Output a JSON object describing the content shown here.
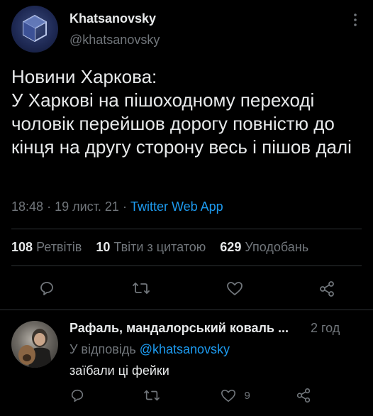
{
  "tweet": {
    "author_name": "Khatsanovsky",
    "author_handle": "@khatsanovsky",
    "text": "Новини Харкова:\nУ Харкові на пішоходному переході чоловік перейшов дорогу повністю до кінця на другу сторону весь і пішов далі",
    "time": "18:48",
    "date": "19 лист. 21",
    "source": "Twitter Web App",
    "separator": "·",
    "stats": {
      "retweets_count": "108",
      "retweets_label": "Ретвітів",
      "quotes_count": "10",
      "quotes_label": "Твіти з цитатою",
      "likes_count": "629",
      "likes_label": "Уподобань"
    }
  },
  "reply": {
    "author_name": "Рафаль, мандалорський коваль ...",
    "time_ago": "2 год",
    "reply_prefix": "У відповідь",
    "reply_to": "@khatsanovsky",
    "text": "заїбали ці фейки",
    "like_count": "9"
  },
  "icons": {
    "more": "more-vertical-icon",
    "reply": "speech-bubble-icon",
    "retweet": "retweet-arrows-icon",
    "like": "heart-icon",
    "share": "share-nodes-icon"
  },
  "colors": {
    "background": "#000000",
    "text": "#e7e9ea",
    "muted": "#71767b",
    "accent": "#1d9bf0",
    "divider": "#2f3336"
  }
}
